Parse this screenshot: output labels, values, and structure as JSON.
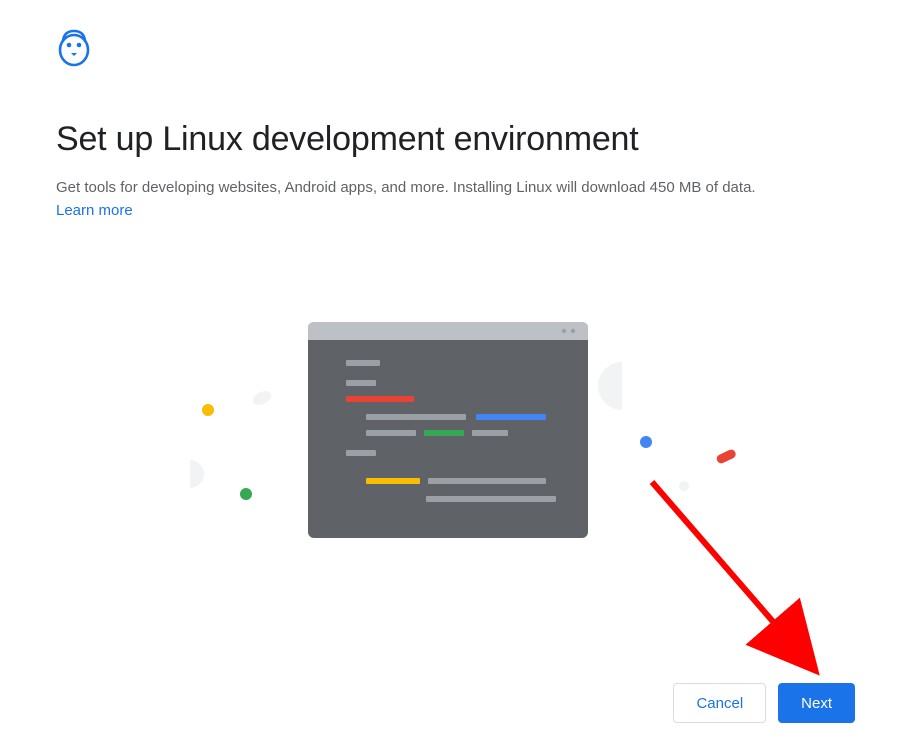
{
  "header": {
    "title": "Set up Linux development environment",
    "description": "Get tools for developing websites, Android apps, and more. Installing Linux will download 450 MB of data.",
    "learn_more": "Learn more"
  },
  "buttons": {
    "cancel": "Cancel",
    "next": "Next"
  },
  "colors": {
    "primary": "#1a73e8",
    "text_secondary": "#5f6368",
    "border": "#dadce0",
    "accent_red": "#ea4335",
    "accent_green": "#34a853",
    "accent_yellow": "#fbbc04",
    "accent_blue": "#4285f4"
  },
  "annotation": {
    "arrow_target": "next-button"
  }
}
